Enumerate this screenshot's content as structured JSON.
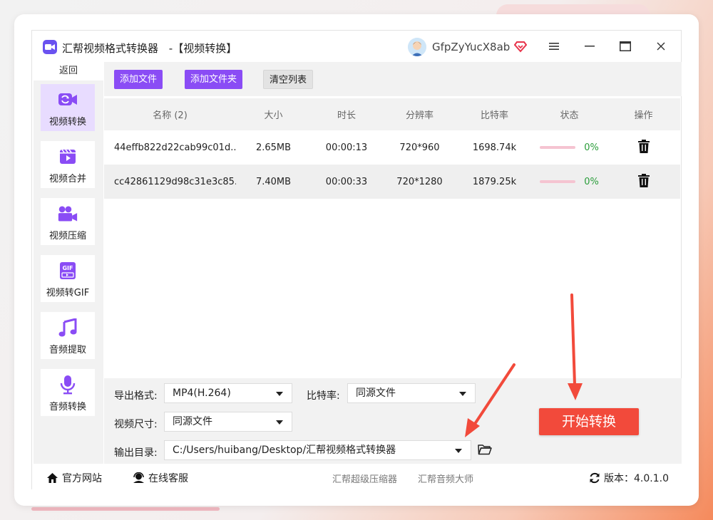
{
  "app": {
    "title": "汇帮视频格式转换器",
    "mode": "-【视频转换】",
    "username": "GfpZyYucX8ab"
  },
  "sidebar": {
    "back": "返回",
    "items": [
      {
        "label": "视频转换",
        "icon": "video-convert-icon"
      },
      {
        "label": "视频合并",
        "icon": "video-merge-icon"
      },
      {
        "label": "视频压缩",
        "icon": "video-compress-icon"
      },
      {
        "label": "视频转GIF",
        "icon": "gif-icon"
      },
      {
        "label": "音频提取",
        "icon": "music-note-icon"
      },
      {
        "label": "音频转换",
        "icon": "microphone-icon"
      }
    ]
  },
  "toolbar": {
    "add_file": "添加文件",
    "add_folder": "添加文件夹",
    "clear_list": "清空列表"
  },
  "table": {
    "headers": {
      "name": "名称 (2)",
      "size": "大小",
      "duration": "时长",
      "resolution": "分辨率",
      "bitrate": "比特率",
      "status": "状态",
      "action": "操作"
    },
    "rows": [
      {
        "name": "44effb822d22cab99c01d...",
        "size": "2.65MB",
        "duration": "00:00:13",
        "resolution": "720*960",
        "bitrate": "1698.74k",
        "progress": 0,
        "percent": "0%"
      },
      {
        "name": "cc42861129d98c31e3c85...",
        "size": "7.40MB",
        "duration": "00:00:33",
        "resolution": "720*1280",
        "bitrate": "1879.25k",
        "progress": 0,
        "percent": "0%"
      }
    ]
  },
  "settings": {
    "format_label": "导出格式:",
    "format_value": "MP4(H.264)",
    "bitrate_label": "比特率:",
    "bitrate_value": "同源文件",
    "size_label": "视频尺寸:",
    "size_value": "同源文件",
    "output_label": "输出目录:",
    "output_value": "C:/Users/huibang/Desktop/汇帮视频格式转换器",
    "start": "开始转换"
  },
  "footer": {
    "website": "官方网站",
    "support": "在线客服",
    "link1": "汇帮超级压缩器",
    "link2": "汇帮音频大师",
    "version": "版本：4.0.1.0"
  },
  "colors": {
    "accent": "#8a4cf5",
    "start_button": "#f24a3b",
    "progress_track": "#f5c4d1",
    "percent_text": "#2a9d3a"
  }
}
